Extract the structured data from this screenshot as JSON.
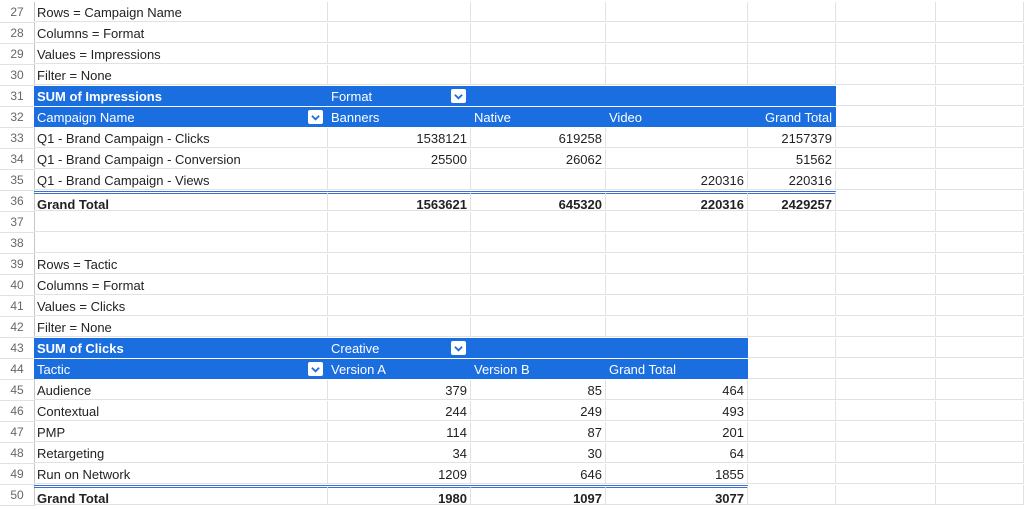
{
  "row_numbers": [
    "27",
    "28",
    "29",
    "30",
    "31",
    "32",
    "33",
    "34",
    "35",
    "36",
    "37",
    "38",
    "39",
    "40",
    "41",
    "42",
    "43",
    "44",
    "45",
    "46",
    "47",
    "48",
    "49",
    "50"
  ],
  "notes1": {
    "rows": "Rows = Campaign Name",
    "columns": "Columns = Format",
    "values": "Values = Impressions",
    "filter": "Filter = None"
  },
  "pivot1": {
    "title": "SUM of Impressions",
    "column_field": "Format",
    "row_field": "Campaign Name",
    "col_headers": [
      "Banners",
      "Native",
      "Video",
      "Grand Total"
    ],
    "rows": [
      {
        "label": "Q1 - Brand Campaign - Clicks",
        "values": [
          "1538121",
          "619258",
          "",
          "2157379"
        ]
      },
      {
        "label": "Q1 - Brand Campaign - Conversion",
        "values": [
          "25500",
          "26062",
          "",
          "51562"
        ]
      },
      {
        "label": "Q1 - Brand Campaign - Views",
        "values": [
          "",
          "",
          "220316",
          "220316"
        ]
      }
    ],
    "total": {
      "label": "Grand Total",
      "values": [
        "1563621",
        "645320",
        "220316",
        "2429257"
      ]
    }
  },
  "notes2": {
    "rows": "Rows = Tactic",
    "columns": "Columns = Format",
    "values": "Values = Clicks",
    "filter": "Filter = None"
  },
  "pivot2": {
    "title": "SUM of Clicks",
    "column_field": "Creative",
    "row_field": "Tactic",
    "col_headers": [
      "Version A",
      "Version B",
      "Grand Total"
    ],
    "rows": [
      {
        "label": "Audience",
        "values": [
          "379",
          "85",
          "464"
        ]
      },
      {
        "label": "Contextual",
        "values": [
          "244",
          "249",
          "493"
        ]
      },
      {
        "label": "PMP",
        "values": [
          "114",
          "87",
          "201"
        ]
      },
      {
        "label": "Retargeting",
        "values": [
          "34",
          "30",
          "64"
        ]
      },
      {
        "label": "Run on Network",
        "values": [
          "1209",
          "646",
          "1855"
        ]
      }
    ],
    "total": {
      "label": "Grand Total",
      "values": [
        "1980",
        "1097",
        "3077"
      ]
    }
  },
  "colors": {
    "header_bg": "#1a6ee0",
    "header_text": "#ffffff",
    "total_border": "#3b6fd1"
  },
  "icons": {
    "filter_dropdown": "chevron-down-icon"
  }
}
